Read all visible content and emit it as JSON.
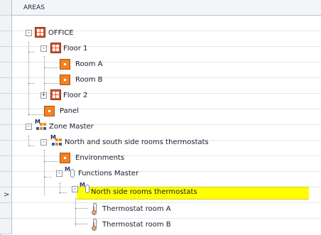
{
  "header": {
    "title": "AREAS"
  },
  "rows": [
    {
      "label": "OFFICE"
    },
    {
      "label": "Floor 1"
    },
    {
      "label": "Room A"
    },
    {
      "label": "Room B"
    },
    {
      "label": "Floor 2"
    },
    {
      "label": "Panel"
    },
    {
      "label": "Zone Master"
    },
    {
      "label": "North and south side rooms thermostats"
    },
    {
      "label": "Environments"
    },
    {
      "label": "Functions Master"
    },
    {
      "label": "North side rooms thermostats"
    },
    {
      "label": "Thermostat room A"
    },
    {
      "label": "Thermostat room B"
    }
  ],
  "selected_row": "North side rooms thermostats",
  "colors": {
    "highlight": "#ffff00",
    "icon_orange": "#f2821f",
    "icon_grid": "#d8572d"
  }
}
